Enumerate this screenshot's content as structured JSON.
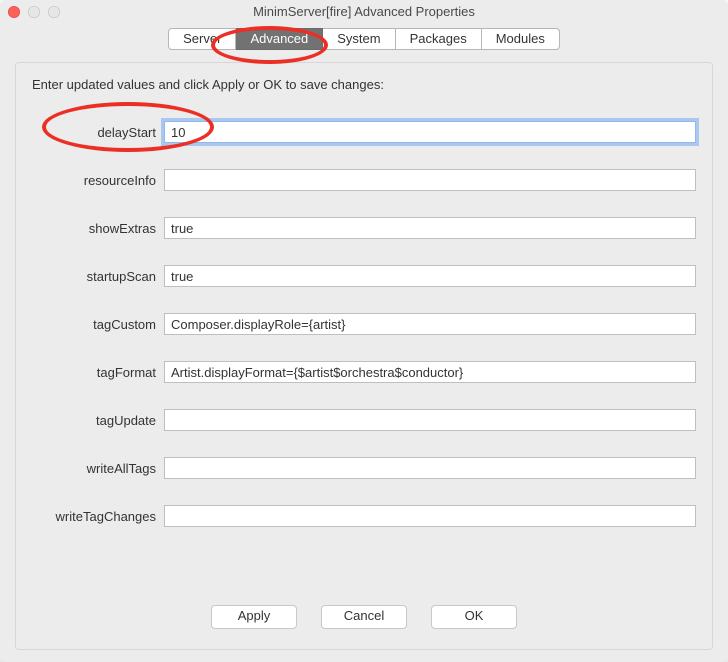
{
  "window": {
    "title": "MinimServer[fire] Advanced Properties"
  },
  "tabs": [
    {
      "id": "server",
      "label": "Server",
      "selected": false
    },
    {
      "id": "advanced",
      "label": "Advanced",
      "selected": true
    },
    {
      "id": "system",
      "label": "System",
      "selected": false
    },
    {
      "id": "packages",
      "label": "Packages",
      "selected": false
    },
    {
      "id": "modules",
      "label": "Modules",
      "selected": false
    }
  ],
  "panel": {
    "instruction": "Enter updated values and click Apply or OK to save changes:",
    "fields": [
      {
        "name": "delayStart",
        "value": "10",
        "focused": true
      },
      {
        "name": "resourceInfo",
        "value": ""
      },
      {
        "name": "showExtras",
        "value": "true"
      },
      {
        "name": "startupScan",
        "value": "true"
      },
      {
        "name": "tagCustom",
        "value": "Composer.displayRole={artist}"
      },
      {
        "name": "tagFormat",
        "value": "Artist.displayFormat={$artist$orchestra$conductor}"
      },
      {
        "name": "tagUpdate",
        "value": ""
      },
      {
        "name": "writeAllTags",
        "value": ""
      },
      {
        "name": "writeTagChanges",
        "value": ""
      }
    ]
  },
  "buttons": {
    "apply": "Apply",
    "cancel": "Cancel",
    "ok": "OK"
  }
}
